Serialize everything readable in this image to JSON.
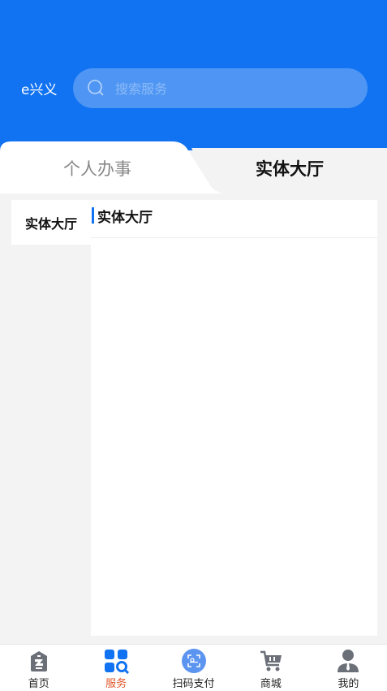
{
  "header": {
    "brand": "e兴义",
    "search": {
      "placeholder": "搜索服务"
    }
  },
  "tabs": [
    {
      "label": "个人办事",
      "active": false
    },
    {
      "label": "实体大厅",
      "active": true
    }
  ],
  "sidebar": {
    "items": [
      {
        "label": "实体大厅",
        "active": true
      }
    ]
  },
  "main": {
    "section_title": "实体大厅"
  },
  "bottom_nav": {
    "items": [
      {
        "label": "首页",
        "icon": "home-icon",
        "active": false
      },
      {
        "label": "服务",
        "icon": "services-icon",
        "active": true
      },
      {
        "label": "扫码支付",
        "icon": "scan-pay-icon",
        "active": false
      },
      {
        "label": "商城",
        "icon": "cart-icon",
        "active": false
      },
      {
        "label": "我的",
        "icon": "profile-icon",
        "active": false
      }
    ]
  },
  "colors": {
    "primary": "#1173f1",
    "active_nav": "#e2562a",
    "icon_gray": "#6b7078"
  }
}
